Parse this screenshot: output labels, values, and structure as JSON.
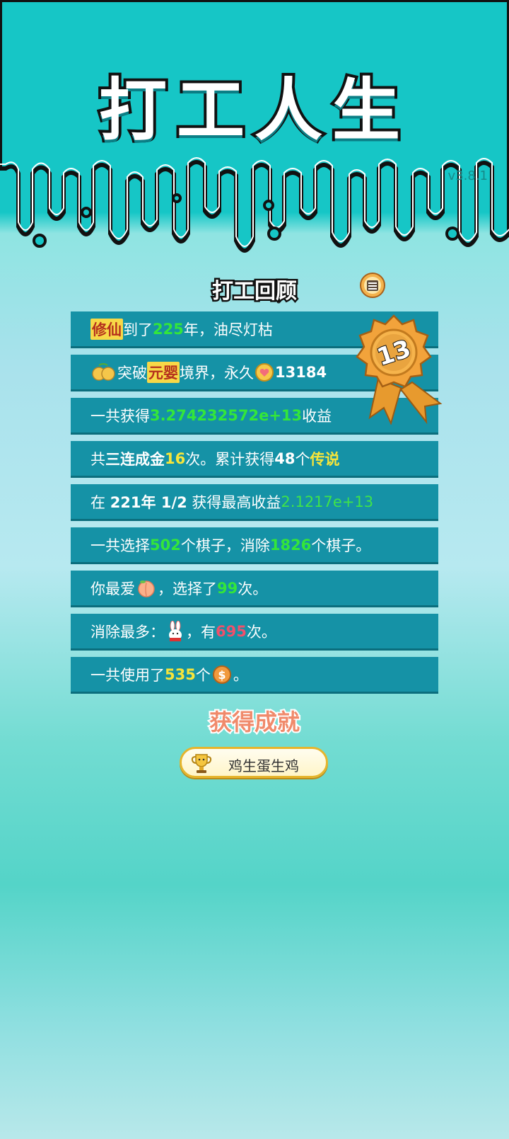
{
  "header": {
    "title": "打工人生",
    "version": "v3.8.1"
  },
  "review": {
    "title": "打工回顾",
    "medal_level": "13",
    "rows": [
      {
        "a": "修仙",
        "b": "到了",
        "c": "225",
        "d": "年，油尽灯枯"
      },
      {
        "a": "突破",
        "b": "元婴",
        "c": "境界，永久",
        "d": "13184"
      },
      {
        "a": "一共获得",
        "b": "3.274232572e+13",
        "c": "收益"
      },
      {
        "a": "共",
        "b": "三连成金",
        "c": "16",
        "d": "次。累计获得",
        "e": "48",
        "f": "个",
        "g": "传说"
      },
      {
        "a": "在 ",
        "b": "221年 1/2",
        "c": " 获得最高收益",
        "d": "2.1217e+13"
      },
      {
        "a": "一共选择",
        "b": "502",
        "c": "个棋子，消除",
        "d": "1826",
        "e": "个棋子。"
      },
      {
        "a": "你最爱",
        "b": "，选择了",
        "c": "99",
        "d": "次。"
      },
      {
        "a": "消除最多：",
        "b": "，有",
        "c": "695",
        "d": "次。"
      },
      {
        "a": "一共使用了",
        "b": "535",
        "c": "个",
        "d": "。"
      }
    ]
  },
  "achievements": {
    "title": "获得成就",
    "badge_label": "鸡生蛋生鸡"
  },
  "icons": [
    "share-icon",
    "medal-icon",
    "pear-icon",
    "coin-heart-icon",
    "peach-icon",
    "rabbit-icon",
    "coin-dollar-icon",
    "trophy-icon"
  ],
  "colors": {
    "bg": "#16c6c6",
    "row_bg": "#1592a6",
    "green": "#33e63a",
    "yellow": "#f7e53a",
    "red": "#f0506b"
  }
}
